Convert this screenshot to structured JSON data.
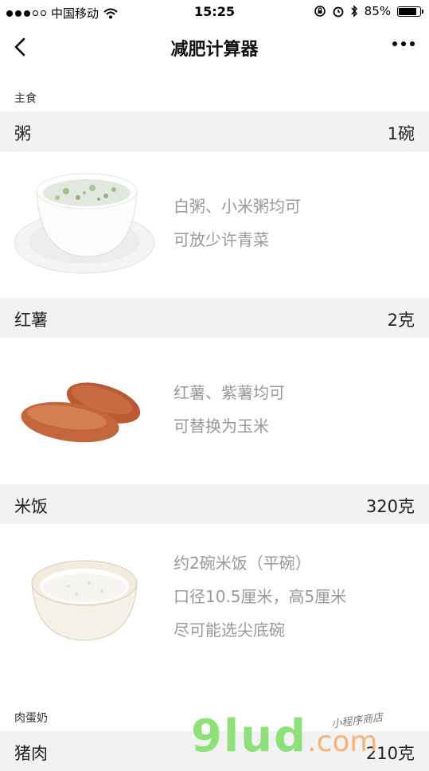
{
  "status_bar": {
    "carrier": "中国移动",
    "time": "15:25",
    "battery": "85%",
    "battery_level": 0.85
  },
  "nav": {
    "title": "减肥计算器"
  },
  "sections": {
    "staple_label": "主食",
    "protein_label": "肉蛋奶"
  },
  "foods": [
    {
      "name": "粥",
      "qty": "1碗",
      "desc": [
        "白粥、小米粥均可",
        "可放少许青菜"
      ]
    },
    {
      "name": "红薯",
      "qty": "2克",
      "desc": [
        "红薯、紫薯均可",
        "可替换为玉米"
      ]
    },
    {
      "name": "米饭",
      "qty": "320克",
      "desc": [
        "约2碗米饭（平碗）",
        "口径10.5厘米，高5厘米",
        "尽可能选尖底碗"
      ]
    },
    {
      "name": "猪肉",
      "qty": "210克"
    }
  ],
  "watermark": {
    "logo": "9lud",
    "suffix": ".com",
    "tagline": "小程序商店"
  }
}
